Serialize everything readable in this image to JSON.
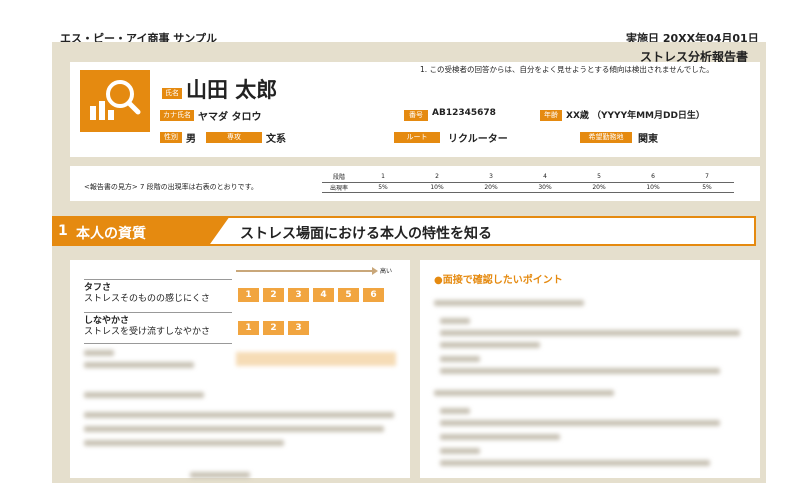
{
  "header": {
    "company": "エス・ピー・アイ商事 サンプル",
    "date": "実施日 20XX年04月01日",
    "report_title": "ストレス分析報告書"
  },
  "profile": {
    "note": "1. この受検者の回答からは、自分をよく見せようとする傾向は検出されませんでした。",
    "name_label": "氏名",
    "name": "山田 太郎",
    "kana_label": "カナ氏名",
    "kana": "ヤマダ タロウ",
    "id_label": "番号",
    "id": "AB12345678",
    "age_label": "年齢",
    "age": "XX歳 （YYYY年MM月DD日生）",
    "gender_label": "性別",
    "gender": "男",
    "major_label": "専攻",
    "major": "文系",
    "route_label": "ルート",
    "route": "リクルーター",
    "location_label": "希望勤務地",
    "location": "関東"
  },
  "howto": {
    "label": "<報告書の見方> 7 段階の出現率は右表のとおりです。",
    "row1_label": "段階",
    "row2_label": "出現率",
    "levels": [
      "1",
      "2",
      "3",
      "4",
      "5",
      "6",
      "7"
    ],
    "rates": [
      "5%",
      "10%",
      "20%",
      "30%",
      "20%",
      "10%",
      "5%"
    ]
  },
  "section": {
    "number": "1",
    "heading": "本人の資質",
    "subtitle": "ストレス場面における本人の特性を知る"
  },
  "traits": {
    "high_label": "高い",
    "items": [
      {
        "title": "タフさ",
        "desc": "ストレスそのものの感じにくさ",
        "scale": [
          "1",
          "2",
          "3",
          "4",
          "5",
          "6"
        ]
      },
      {
        "title": "しなやかさ",
        "desc": "ストレスを受け流すしなやかさ",
        "scale": [
          "1",
          "2",
          "3"
        ]
      }
    ]
  },
  "points": {
    "title": "●面接で確認したいポイント"
  },
  "colors": {
    "accent": "#e58a10",
    "scale": "#f1a540",
    "frame": "#e5dfcd"
  },
  "icons": {
    "avatar": "magnifier-chart-icon"
  }
}
